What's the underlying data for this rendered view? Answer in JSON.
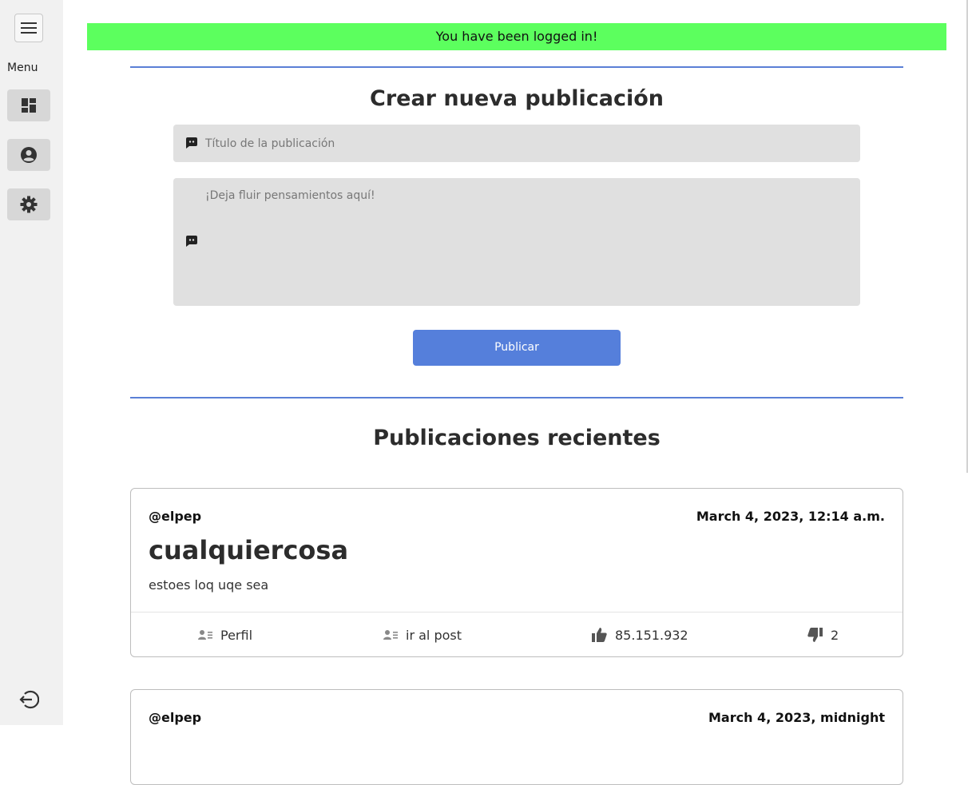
{
  "sidebar": {
    "menu_label": "Menu",
    "items": [
      {
        "icon": "dashboard-icon"
      },
      {
        "icon": "profile-icon"
      },
      {
        "icon": "gear-icon"
      }
    ],
    "logout_icon": "logout-icon"
  },
  "alert": {
    "text": "You have been logged in!",
    "color": "#5cff5e"
  },
  "create": {
    "heading": "Crear nueva publicación",
    "title_placeholder": "Título de la publicación",
    "body_placeholder": "¡Deja fluir pensamientos aquí!",
    "publish_label": "Publicar",
    "accent": "#557fdb"
  },
  "recent": {
    "heading": "Publicaciones recientes",
    "posts": [
      {
        "author": "@elpep",
        "date": "March 4, 2023, 12:14 a.m.",
        "title": "cualquiercosa",
        "body": "estoes loq uqe sea",
        "profile_label": "Perfil",
        "goto_label": "ir al post",
        "likes": "85.151.932",
        "dislikes": "2"
      },
      {
        "author": "@elpep",
        "date": "March 4, 2023, midnight"
      }
    ]
  }
}
